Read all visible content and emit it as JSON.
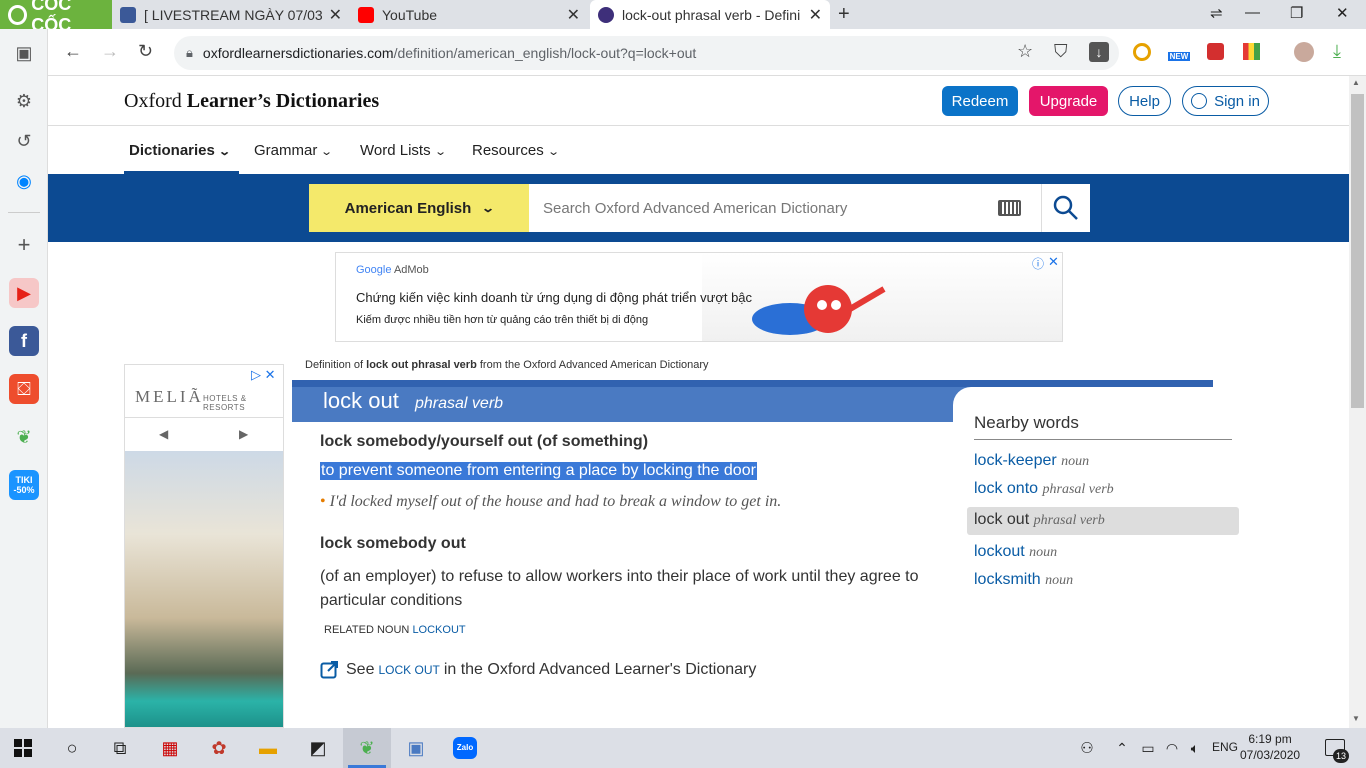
{
  "browser": {
    "brand": "CỐC CỐC",
    "tabs": [
      {
        "title": "[ LIVESTREAM NGÀY 07/03 - "
      },
      {
        "title": "YouTube"
      },
      {
        "title": "lock-out phrasal verb - Defini"
      }
    ],
    "address": {
      "host": "oxfordlearnersdictionaries.com",
      "path": "/definition/american_english/lock-out?q=lock+out"
    },
    "extension_badge": "NEW"
  },
  "sidebar": {
    "tiki_label": "TIKI -50%"
  },
  "site": {
    "logo_regular": "Oxford",
    "logo_bold": "Learner’s Dictionaries",
    "buttons": {
      "redeem": "Redeem",
      "upgrade": "Upgrade",
      "help": "Help",
      "signin": "Sign in"
    },
    "nav": [
      "Dictionaries",
      "Grammar",
      "Word Lists",
      "Resources"
    ],
    "dictionary_select": "American English",
    "search_placeholder": "Search Oxford Advanced American Dictionary"
  },
  "ad_top": {
    "brand_google": "Google",
    "brand_admob": "AdMob",
    "line1": "Chứng kiến việc kinh doanh từ ứng dụng di động phát triển vượt bậc",
    "line2": "Kiếm được nhiều tiền hơn từ quảng cáo trên thiết bị di động"
  },
  "ad_left": {
    "brand": "MELIÃ",
    "sub": "HOTELS & RESORTS"
  },
  "entry": {
    "crumb_pre": "Definition of ",
    "crumb_bold": "lock out phrasal verb",
    "crumb_post": " from the Oxford Advanced American Dictionary",
    "headword": "lock out",
    "pos": "phrasal verb",
    "idiom1": "lock somebody/yourself out (of something)",
    "def1": "to prevent someone from entering a place by locking the door",
    "example1": "I'd locked myself out of the house and had to break a window to get in.",
    "idiom2": "lock somebody out",
    "def2": "(of an employer) to refuse to allow workers into their place of work until they agree to particular conditions",
    "related_label": "RELATED NOUN",
    "related_link": "LOCKOUT",
    "see_pre": "See",
    "see_link": "LOCK OUT",
    "see_post": "in the Oxford Advanced Learner's Dictionary"
  },
  "nearby": {
    "title": "Nearby words",
    "words": [
      {
        "word": "lock-keeper",
        "pos": "noun"
      },
      {
        "word": "lock onto",
        "pos": "phrasal verb"
      },
      {
        "word": "lock out",
        "pos": "phrasal verb"
      },
      {
        "word": "lockout",
        "pos": "noun"
      },
      {
        "word": "locksmith",
        "pos": "noun"
      }
    ]
  },
  "taskbar": {
    "lang": "ENG",
    "time": "6:19 pm",
    "date": "07/03/2020",
    "notif_count": "13"
  },
  "colors": {
    "oxford_blue": "#0c4a92",
    "redeem": "#0b73c8",
    "upgrade": "#e4166a",
    "selector_yellow": "#f4e96b",
    "coccoc_green": "#6cb33e",
    "selection": "#3a79d8"
  }
}
